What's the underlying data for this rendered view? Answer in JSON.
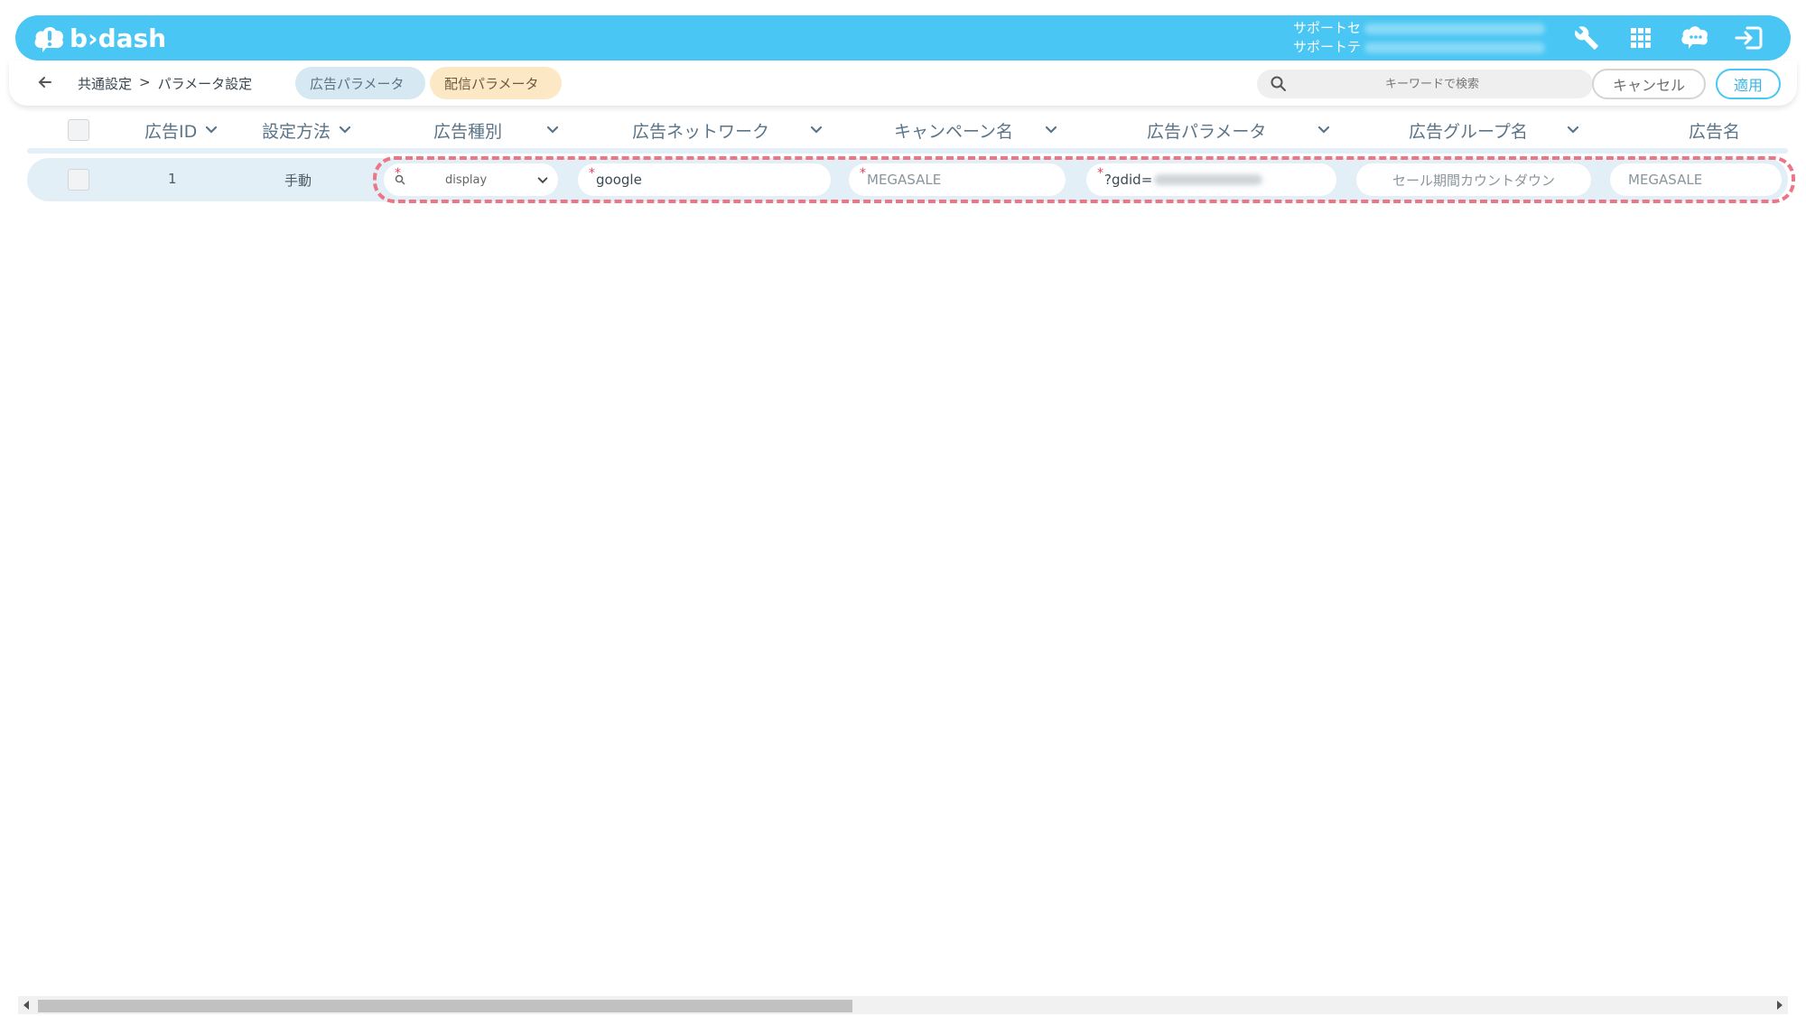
{
  "app": {
    "logo_text": "b›dash"
  },
  "header": {
    "support_lines": [
      "サポートセ",
      "サポートテ"
    ],
    "icons": [
      "wrench-icon",
      "grid-icon",
      "chat-bubble-icon",
      "logout-icon"
    ]
  },
  "subheader": {
    "breadcrumb": [
      "共通設定",
      ">",
      "パラメータ設定"
    ],
    "tabs": [
      {
        "label": "広告パラメータ",
        "active": true,
        "color": "#d6e9f3"
      },
      {
        "label": "配信パラメータ",
        "active": false,
        "color": "#fde8c6"
      }
    ],
    "search": {
      "placeholder": "キーワードで検索"
    },
    "cancel_label": "キャンセル",
    "apply_label": "適用"
  },
  "table": {
    "columns": [
      "広告ID",
      "設定方法",
      "広告種別",
      "広告ネットワーク",
      "キャンペーン名",
      "広告パラメータ",
      "広告グループ名",
      "広告名"
    ],
    "rows": [
      {
        "ad_id": "1",
        "method": "手動",
        "ad_type": "display",
        "network": "google",
        "campaign": "MEGASALE",
        "parameter": "?gdid=",
        "ad_group": "セール期間カウントダウン",
        "ad_name": "MEGASALE"
      }
    ]
  },
  "colors": {
    "topbar": "#49c6f3",
    "highlight": "#ec7586",
    "row_bg": "#e3eff7"
  }
}
